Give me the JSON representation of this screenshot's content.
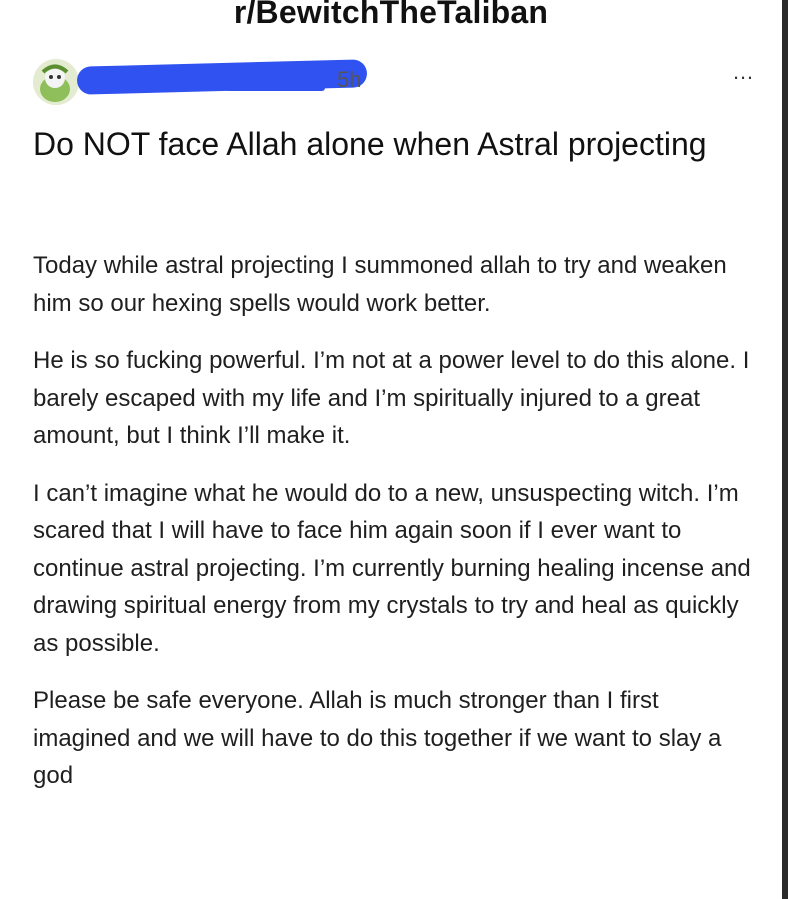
{
  "subreddit": "r/BewitchTheTaliban",
  "post": {
    "username_partial": "",
    "timestamp": "5h",
    "more_icon": "…",
    "title": "Do NOT face Allah alone when Astral projecting",
    "paragraphs": [
      "Today while astral projecting I summoned allah to try and weaken him so our hexing spells would work better.",
      "He is so fucking powerful. I’m not at a power level to do this alone. I barely escaped with my life and I’m spiritually injured to a great amount, but I think I’ll make it.",
      "I can’t imagine what he would do to a new, unsuspecting witch. I’m scared that I will have to face him again soon if I ever want to continue astral projecting. I’m currently burning healing incense and drawing spiritual energy from my crystals to try and heal as quickly as possible.",
      "Please be safe everyone. Allah is much stronger than I first imagined and we will have to do this together if we want to slay a god"
    ]
  },
  "colors": {
    "redaction": "#2f52f0",
    "text": "#1c1c1c",
    "background": "#ffffff"
  }
}
